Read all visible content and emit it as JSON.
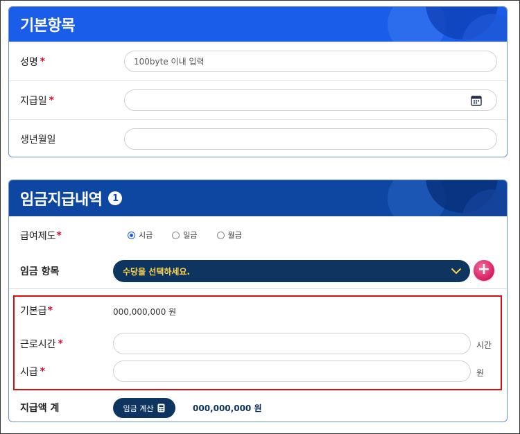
{
  "basic": {
    "title": "기본항목",
    "name_label": "성명",
    "name_placeholder": "100byte 이내 입력",
    "paydate_label": "지급일",
    "birth_label": "생년월일",
    "required_mark": "*"
  },
  "wage": {
    "title": "임금지급내역",
    "badge": "1",
    "system_label": "급여제도",
    "options": [
      "시급",
      "일급",
      "월급"
    ],
    "selected_option": "시급",
    "items_label": "임금 항목",
    "select_placeholder": "수당을 선택하세요.",
    "base_label": "기본급",
    "base_value": "000,000,000 원",
    "hours_label": "근로시간",
    "hours_unit": "시간",
    "hourly_label": "시급",
    "hourly_unit": "원",
    "total_label": "지급액 계",
    "calc_button": "임금 계산",
    "total_value": "000,000,000 원",
    "required_mark": "*"
  },
  "colors": {
    "header_blue": "#1a5de8",
    "header_navy": "#0d47a1",
    "button_navy": "#0d3560",
    "required_red": "#d0112b",
    "highlight_red": "#d70e0e",
    "select_text_yellow": "#ffd54a",
    "plus_pink": "#d81b60"
  },
  "icons": [
    "calendar-icon",
    "chevron-down-icon",
    "plus-icon",
    "calculator-icon",
    "radio-icon"
  ]
}
